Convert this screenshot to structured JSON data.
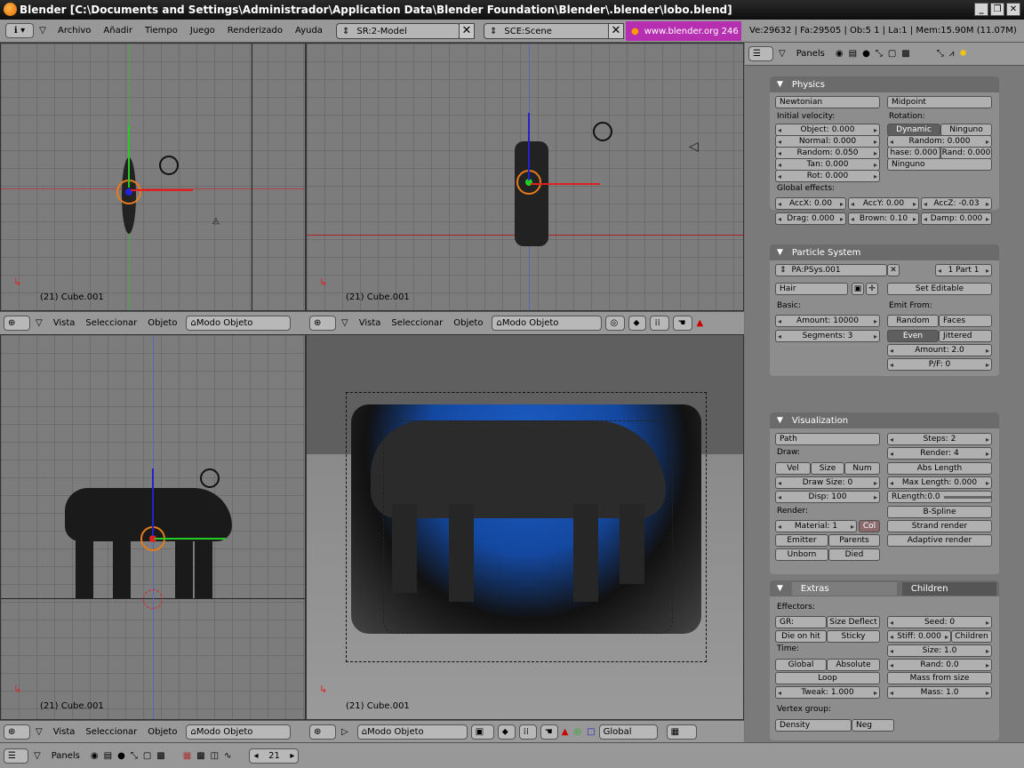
{
  "window": {
    "title": "Blender [C:\\Documents and Settings\\Administrador\\Application Data\\Blender Foundation\\Blender\\.blender\\lobo.blend]"
  },
  "menu": {
    "items": [
      "Archivo",
      "Añadir",
      "Tiempo",
      "Juego",
      "Renderizado",
      "Ayuda"
    ],
    "screen": "SR:2-Model",
    "scene": "SCE:Scene",
    "website": "www.blender.org 246",
    "stats": "Ve:29632 | Fa:29505 | Ob:5 1 | La:1 | Mem:15.90M (11.07M)"
  },
  "viewports": {
    "label": "(21) Cube.001",
    "header": {
      "vista": "Vista",
      "seleccionar": "Seleccionar",
      "objeto": "Objeto",
      "mode": "Modo Objeto",
      "orientation": "Global"
    }
  },
  "props_header": {
    "panels": "Panels"
  },
  "physics": {
    "title": "Physics",
    "type": "Newtonian",
    "rot_mode": "Midpoint",
    "initial_velocity": "Initial velocity:",
    "rotation": "Rotation:",
    "object": "Object: 0.000",
    "normal": "Normal: 0.000",
    "random": "Random: 0.050",
    "tan": "Tan: 0.000",
    "rot": "Rot: 0.000",
    "dynamic": "Dynamic",
    "ninguno": "Ninguno",
    "rot_random": "Random: 0.000",
    "phase": "hase: 0.000",
    "rand": "Rand: 0.000",
    "ninguno2": "Ninguno",
    "global_effects": "Global effects:",
    "accx": "AccX: 0.00",
    "accy": "AccY: 0.00",
    "accz": "AccZ: -0.03",
    "drag": "Drag: 0.000",
    "brown": "Brown: 0.10",
    "damp": "Damp: 0.000"
  },
  "particle_system": {
    "title": "Particle System",
    "name": "PA:PSys.001",
    "part": "1 Part 1",
    "type": "Hair",
    "set_editable": "Set Editable",
    "basic": "Basic:",
    "emit_from": "Emit From:",
    "amount": "Amount: 10000",
    "segments": "Segments: 3",
    "random": "Random",
    "faces": "Faces",
    "even": "Even",
    "jittered": "Jittered",
    "amount2": "Amount: 2.0",
    "pf": "P/F: 0"
  },
  "visualization": {
    "title": "Visualization",
    "draw_as": "Path",
    "steps": "Steps: 2",
    "render": "Render: 4",
    "draw": "Draw:",
    "vel": "Vel",
    "size": "Size",
    "num": "Num",
    "abs_length": "Abs Length",
    "draw_size": "Draw Size: 0",
    "max_length": "Max Length: 0.000",
    "disp": "Disp: 100",
    "rlength": "RLength:0.0",
    "render_label": "Render:",
    "bspline": "B-Spline",
    "material": "Material: 1",
    "col": "Col",
    "strand_render": "Strand render",
    "emitter": "Emitter",
    "parents": "Parents",
    "adaptive_render": "Adaptive render",
    "unborn": "Unborn",
    "died": "Died"
  },
  "extras": {
    "tab_extras": "Extras",
    "tab_children": "Children",
    "effectors": "Effectors:",
    "gr": "GR:",
    "size_deflect": "Size Deflect",
    "seed": "Seed: 0",
    "die_on_hit": "Die on hit",
    "sticky": "Sticky",
    "stiff": "Stiff: 0.000",
    "children": "Children",
    "time": "Time:",
    "size": "Size: 1.0",
    "global": "Global",
    "absolute": "Absolute",
    "rand": "Rand: 0.0",
    "loop": "Loop",
    "mass_from_size": "Mass from size",
    "tweak": "Tweak: 1.000",
    "mass": "Mass: 1.0",
    "vertex_group": "Vertex group:",
    "density": "Density",
    "neg": "Neg"
  },
  "bottom": {
    "panels": "Panels",
    "frame": "21"
  }
}
